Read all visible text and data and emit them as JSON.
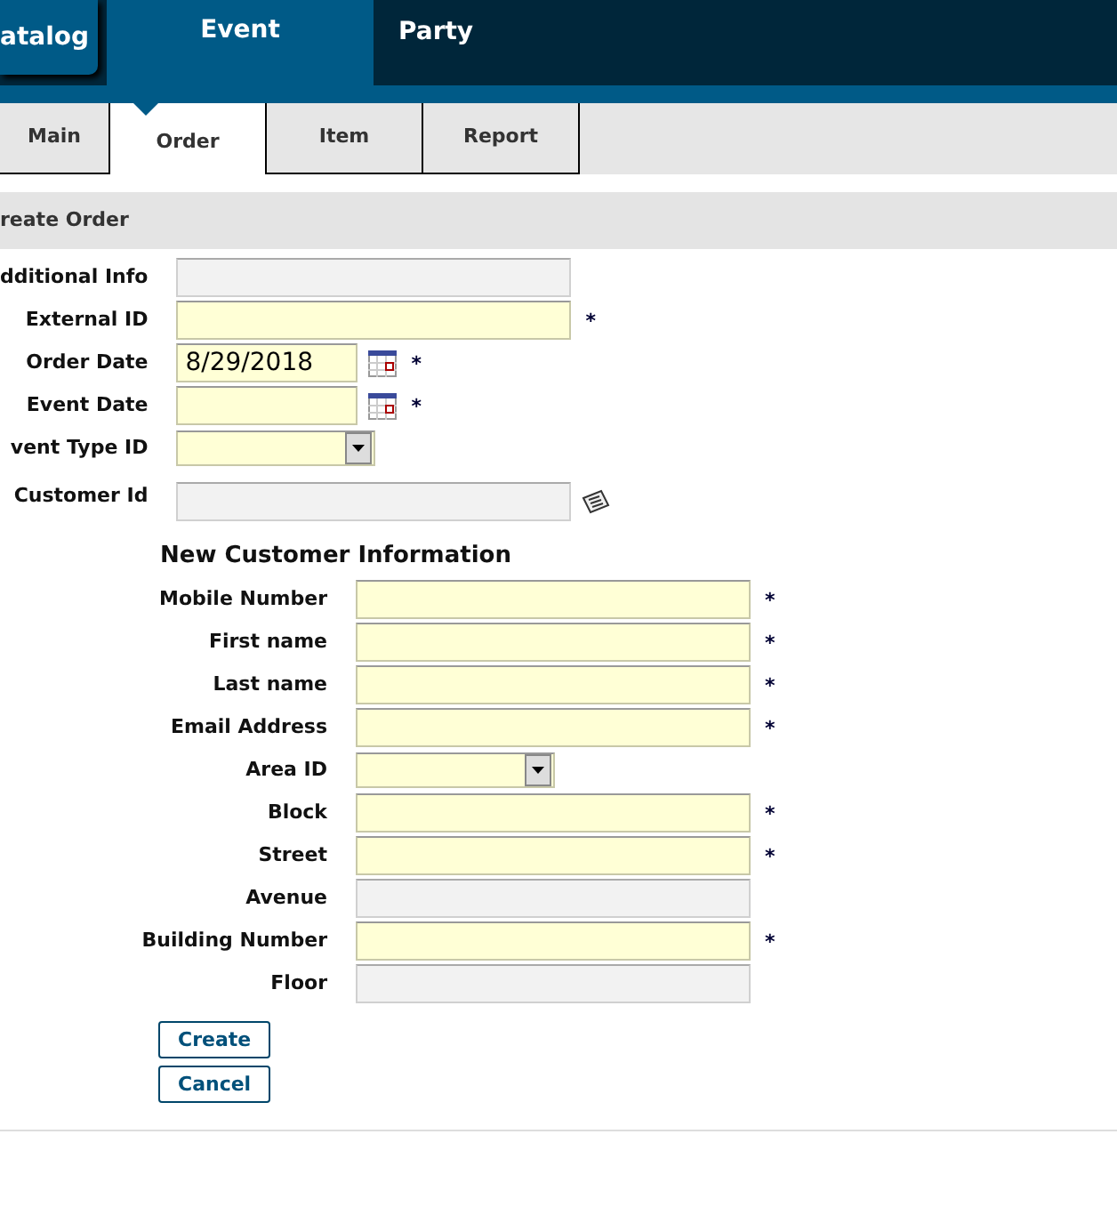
{
  "main_tabs": [
    {
      "label": "atalog",
      "selected": false
    },
    {
      "label": "Event",
      "selected": true
    },
    {
      "label": "Party",
      "selected": false
    }
  ],
  "sub_tabs": [
    {
      "label": "Main",
      "selected": false
    },
    {
      "label": "Order",
      "selected": true
    },
    {
      "label": "Item",
      "selected": false
    },
    {
      "label": "Report",
      "selected": false
    }
  ],
  "section_title": "reate Order",
  "order_fields": [
    {
      "label": "dditional Info",
      "kind": "text",
      "highlighted": false
    },
    {
      "label": "External ID",
      "kind": "text",
      "highlighted": true,
      "required_mark": "*"
    },
    {
      "label": "Order Date",
      "kind": "date",
      "value": "8/29/2018",
      "highlighted": true,
      "required_mark": "*"
    },
    {
      "label": "Event Date",
      "kind": "date",
      "highlighted": true,
      "required_mark": "*"
    },
    {
      "label": "vent Type ID",
      "kind": "select",
      "highlighted": true
    },
    {
      "label": "Customer Id",
      "kind": "lookup",
      "highlighted": false
    }
  ],
  "customer_title": "New Customer Information",
  "customer_fields": [
    {
      "label": "Mobile Number",
      "kind": "text",
      "highlighted": true,
      "required_mark": "*"
    },
    {
      "label": "First name",
      "kind": "text",
      "highlighted": true,
      "required_mark": "*"
    },
    {
      "label": "Last name",
      "kind": "text",
      "highlighted": true,
      "required_mark": "*"
    },
    {
      "label": "Email Address",
      "kind": "text",
      "highlighted": true,
      "required_mark": "*"
    },
    {
      "label": "Area ID",
      "kind": "select",
      "highlighted": true
    },
    {
      "label": "Block",
      "kind": "text",
      "highlighted": true,
      "required_mark": "*"
    },
    {
      "label": "Street",
      "kind": "text",
      "highlighted": true,
      "required_mark": "*"
    },
    {
      "label": "Avenue",
      "kind": "text",
      "highlighted": false
    },
    {
      "label": "Building Number",
      "kind": "text",
      "highlighted": true,
      "required_mark": "*"
    },
    {
      "label": "Floor",
      "kind": "text",
      "highlighted": false
    }
  ],
  "buttons": [
    "Create",
    "Cancel"
  ]
}
